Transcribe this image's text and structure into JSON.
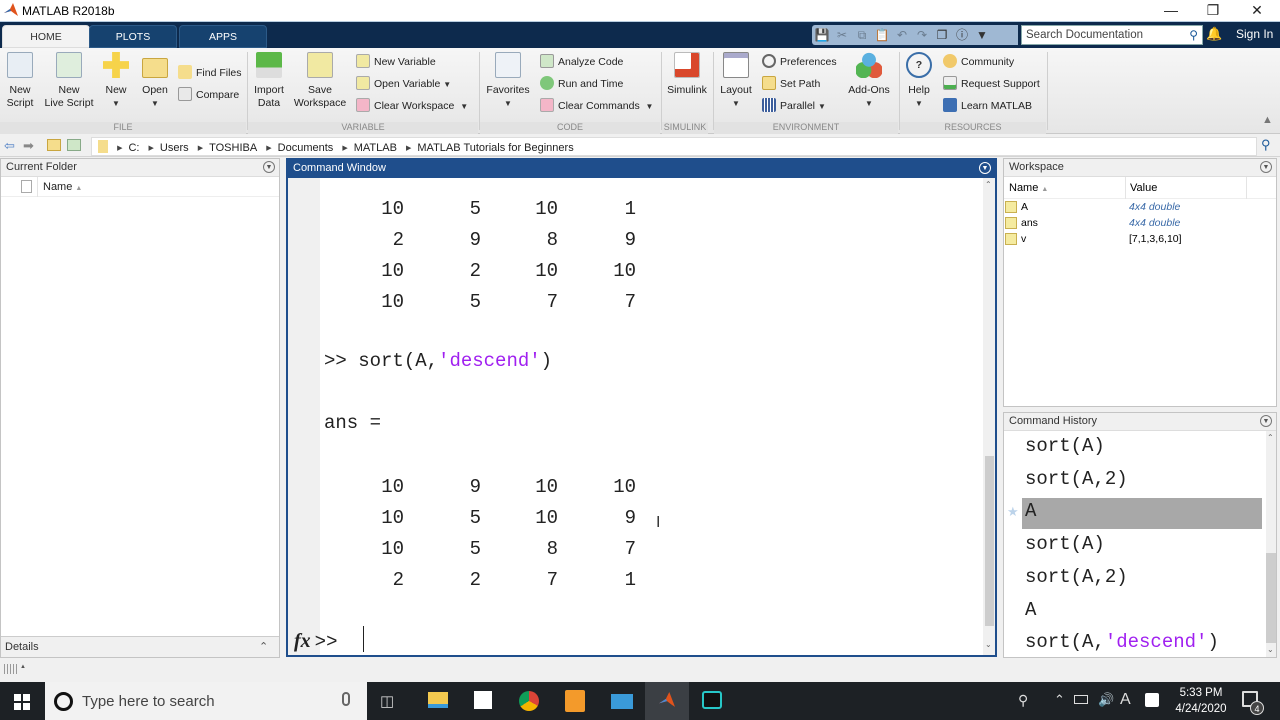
{
  "window": {
    "title": "MATLAB R2018b",
    "controls": [
      "minimize",
      "restore",
      "close"
    ]
  },
  "ribbon": {
    "tabs": [
      {
        "label": "HOME",
        "active": true
      },
      {
        "label": "PLOTS",
        "active": false
      },
      {
        "label": "APPS",
        "active": false
      }
    ],
    "search_placeholder": "Search Documentation",
    "sign_in": "Sign In",
    "groups": {
      "file": {
        "name": "FILE",
        "new_script": "New\nScript",
        "new_live_script": "New\nLive Script",
        "new": "New",
        "open": "Open",
        "find_files": "Find Files",
        "compare": "Compare"
      },
      "variable": {
        "name": "VARIABLE",
        "import_data": "Import\nData",
        "save_workspace": "Save\nWorkspace",
        "new_variable": "New Variable",
        "open_variable": "Open Variable",
        "clear_workspace": "Clear Workspace"
      },
      "code": {
        "name": "CODE",
        "favorites": "Favorites",
        "analyze_code": "Analyze Code",
        "run_and_time": "Run and Time",
        "clear_commands": "Clear Commands"
      },
      "simulink": {
        "name": "SIMULINK",
        "simulink": "Simulink"
      },
      "environment": {
        "name": "ENVIRONMENT",
        "layout": "Layout",
        "preferences": "Preferences",
        "set_path": "Set Path",
        "parallel": "Parallel",
        "add_ons": "Add-Ons"
      },
      "resources": {
        "name": "RESOURCES",
        "help": "Help",
        "community": "Community",
        "request_support": "Request Support",
        "learn_matlab": "Learn MATLAB"
      }
    }
  },
  "address": {
    "crumbs": [
      "C:",
      "Users",
      "TOSHIBA",
      "Documents",
      "MATLAB",
      "MATLAB Tutorials for Beginners"
    ]
  },
  "current_folder": {
    "title": "Current Folder",
    "col_name": "Name",
    "details": "Details"
  },
  "command_window": {
    "title": "Command Window",
    "prev_matrix": [
      [
        "10",
        "5",
        "10",
        "1"
      ],
      [
        "2",
        "9",
        "8",
        "9"
      ],
      [
        "10",
        "2",
        "10",
        "10"
      ],
      [
        "10",
        "5",
        "7",
        "7"
      ]
    ],
    "command_prompt": ">>",
    "command_code": "sort(A,",
    "command_string": "'descend'",
    "command_close": ")",
    "ans_label": "ans =",
    "ans_matrix": [
      [
        "10",
        "9",
        "10",
        "10"
      ],
      [
        "10",
        "5",
        "10",
        "9"
      ],
      [
        "10",
        "5",
        "8",
        "7"
      ],
      [
        "2",
        "2",
        "7",
        "1"
      ]
    ],
    "fx": "fx",
    "prompt": ">>"
  },
  "workspace": {
    "title": "Workspace",
    "col_name": "Name",
    "col_value": "Value",
    "vars": [
      {
        "name": "A",
        "value": "4x4 double"
      },
      {
        "name": "ans",
        "value": "4x4 double"
      },
      {
        "name": "v",
        "value": "[7,1,3,6,10]"
      }
    ]
  },
  "history": {
    "title": "Command History",
    "items": [
      {
        "code": "sort(A)",
        "str": ""
      },
      {
        "code": "sort(A,2)",
        "str": ""
      },
      {
        "code": "A",
        "str": "",
        "selected": true
      },
      {
        "code": "sort(A)",
        "str": ""
      },
      {
        "code": "sort(A,2)",
        "str": ""
      },
      {
        "code": "A",
        "str": ""
      },
      {
        "code": "sort(A,",
        "str": "'descend'",
        "tail": ")"
      }
    ]
  },
  "taskbar": {
    "search_placeholder": "Type here to search",
    "time": "5:33 PM",
    "date": "4/24/2020",
    "notifications": "4",
    "lang": "A"
  }
}
